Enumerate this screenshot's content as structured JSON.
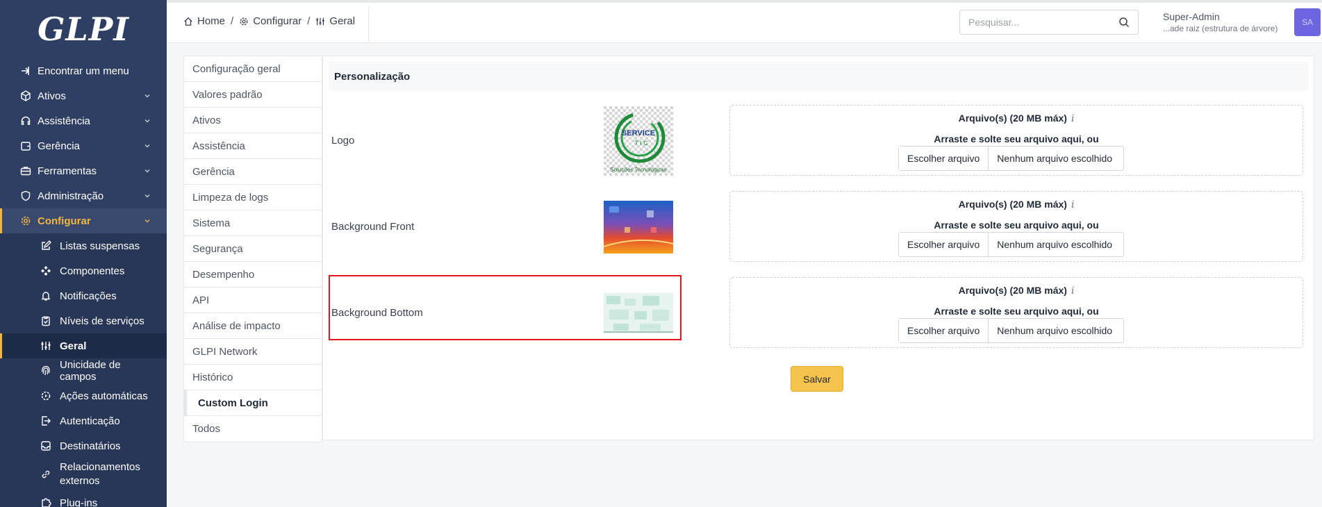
{
  "sidebar": {
    "logo": "GLPI",
    "items": [
      {
        "label": "Encontrar um menu",
        "icon": "arrow-right-icon",
        "chevron": false
      },
      {
        "label": "Ativos",
        "icon": "box-icon",
        "chevron": true
      },
      {
        "label": "Assistência",
        "icon": "headset-icon",
        "chevron": true
      },
      {
        "label": "Gerência",
        "icon": "wallet-icon",
        "chevron": true
      },
      {
        "label": "Ferramentas",
        "icon": "briefcase-icon",
        "chevron": true
      },
      {
        "label": "Administração",
        "icon": "shield-icon",
        "chevron": true
      },
      {
        "label": "Configurar",
        "icon": "gear-icon",
        "chevron": true,
        "active": true
      }
    ],
    "submenu": [
      {
        "label": "Listas suspensas",
        "icon": "edit-icon"
      },
      {
        "label": "Componentes",
        "icon": "components-icon"
      },
      {
        "label": "Notificações",
        "icon": "bell-icon"
      },
      {
        "label": "Níveis de serviços",
        "icon": "clipboard-check-icon"
      },
      {
        "label": "Geral",
        "icon": "adjustments-icon",
        "current": true
      },
      {
        "label": "Unicidade de campos",
        "icon": "fingerprint-icon"
      },
      {
        "label": "Ações automáticas",
        "icon": "settings-automation-icon"
      },
      {
        "label": "Autenticação",
        "icon": "login-icon"
      },
      {
        "label": "Destinatários",
        "icon": "inbox-icon"
      },
      {
        "label": "Relacionamentos externos",
        "icon": "link-icon"
      },
      {
        "label": "Plug-ins",
        "icon": "puzzle-icon"
      }
    ]
  },
  "header": {
    "breadcrumb": [
      {
        "label": "Home",
        "icon": "home-icon"
      },
      {
        "label": "Configurar",
        "icon": "gear-icon"
      },
      {
        "label": "Geral",
        "icon": "adjustments-icon"
      }
    ],
    "search_placeholder": "Pesquisar...",
    "user_name": "Super-Admin",
    "user_entity": "...ade raiz (estrutura de árvore)",
    "avatar_initials": "SA"
  },
  "tabs": [
    "Configuração geral",
    "Valores padrão",
    "Ativos",
    "Assistência",
    "Gerência",
    "Limpeza de logs",
    "Sistema",
    "Segurança",
    "Desempenho",
    "API",
    "Análise de impacto",
    "GLPI Network",
    "Histórico",
    "Custom Login",
    "Todos"
  ],
  "active_tab": "Custom Login",
  "panel": {
    "title": "Personalização",
    "rows": [
      {
        "label": "Logo"
      },
      {
        "label": "Background Front"
      },
      {
        "label": "Background Bottom"
      }
    ],
    "dropzone": {
      "title": "Arquivo(s) (20 MB máx)",
      "info": "i",
      "hint": "Arraste e solte seu arquivo aqui, ou",
      "choose": "Escolher arquivo",
      "none": "Nenhum arquivo escolhido"
    },
    "logo_text": "SERVICE",
    "logo_sub": "T I C",
    "logo_caption": "Soluções Tecnológicas",
    "save_label": "Salvar"
  },
  "colors": {
    "sidebar_bg": "#2f3f64",
    "active_accent": "#f4b63f",
    "save_button": "#f6c34d",
    "highlight_border": "#e0161b",
    "avatar_bg": "#6d66e0"
  }
}
